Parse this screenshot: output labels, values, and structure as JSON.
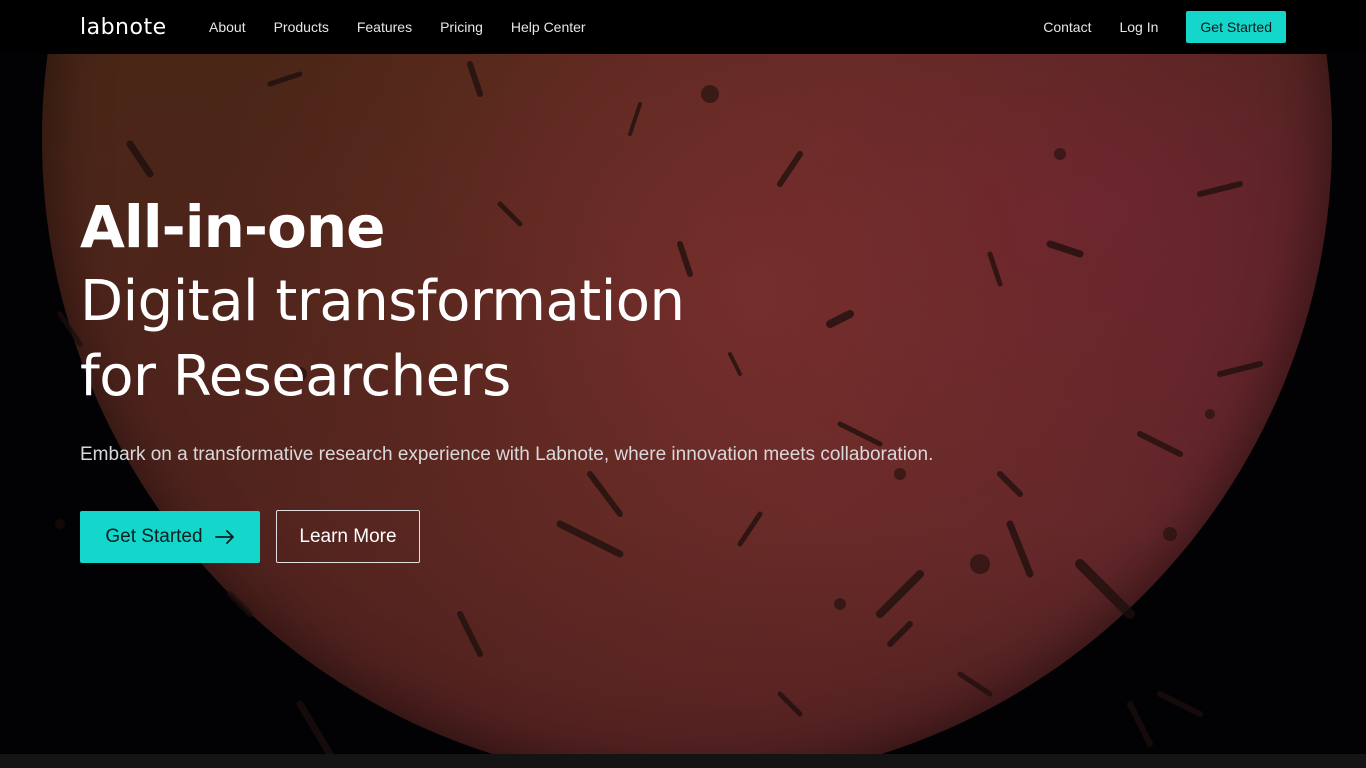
{
  "header": {
    "logo_text": "labnote",
    "nav_left": [
      {
        "label": "About"
      },
      {
        "label": "Products"
      },
      {
        "label": "Features"
      },
      {
        "label": "Pricing"
      },
      {
        "label": "Help Center"
      }
    ],
    "nav_right": {
      "contact": "Contact",
      "login": "Log In",
      "get_started": "Get Started"
    }
  },
  "hero": {
    "headline_line1": "All-in-one",
    "headline_line2": "Digital transformation",
    "headline_line3": "for Researchers",
    "subtitle": "Embark on a transformative research experience with Labnote, where innovation meets collaboration.",
    "primary_cta": "Get Started",
    "secondary_cta": "Learn More"
  },
  "colors": {
    "accent": "#14d6cb",
    "background": "#000000",
    "text": "#ffffff"
  },
  "icons": {
    "cta_arrow": "arrow-right-icon"
  }
}
